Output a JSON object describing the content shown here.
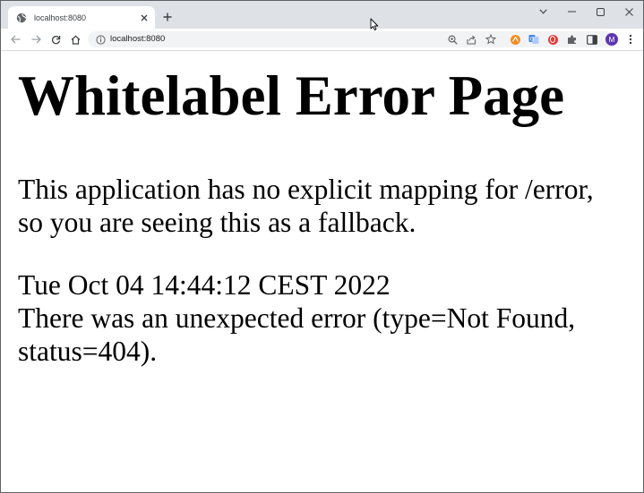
{
  "browser": {
    "tab": {
      "title": "localhost:8080",
      "favicon": "globe-icon"
    },
    "window_controls": [
      "chevron-down-icon",
      "minimize-icon",
      "maximize-icon",
      "close-icon"
    ],
    "toolbar": {
      "url": "localhost:8080",
      "profile_initial": "M"
    }
  },
  "page": {
    "title": "Whitelabel Error Page",
    "message_line1": "This application has no explicit mapping for /error,",
    "message_line2": "so you are seeing this as a fallback.",
    "timestamp": "Tue Oct 04 14:44:12 CEST 2022",
    "error_line1": "There was an unexpected error (type=Not Found,",
    "error_line2": "status=404)."
  },
  "colors": {
    "tabstrip": "#dee1e6",
    "omnibox": "#f1f3f4",
    "profile": "#5e35b1"
  }
}
